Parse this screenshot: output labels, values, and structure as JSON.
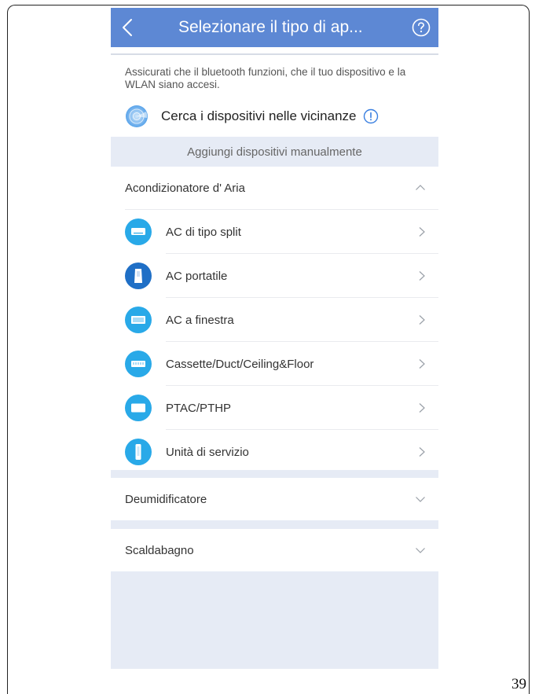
{
  "topbar": {
    "title": "Selezionare il tipo di ap...",
    "back_icon": "chevron-left-icon",
    "help_icon": "question-circle-icon"
  },
  "intro": {
    "text": "Assicurati che il bluetooth funzioni, che il tuo dispositivo e la WLAN siano accesi."
  },
  "nearby": {
    "label": "Cerca i dispositivi nelle vicinanze",
    "icon": "radar-icon",
    "info_icon": "info-icon"
  },
  "manual": {
    "label": "Aggiungi dispositivi manualmente"
  },
  "categories": [
    {
      "label": "Acondizionatore d' Aria",
      "expanded": true,
      "items": [
        {
          "label": "AC di tipo split",
          "icon": "split-ac-icon"
        },
        {
          "label": "AC portatile",
          "icon": "portable-ac-icon"
        },
        {
          "label": "AC a finestra",
          "icon": "window-ac-icon"
        },
        {
          "label": "Cassette/Duct/Ceiling&Floor",
          "icon": "cassette-ac-icon"
        },
        {
          "label": "PTAC/PTHP",
          "icon": "ptac-icon"
        },
        {
          "label": "Unità di servizio",
          "icon": "service-unit-icon"
        }
      ]
    },
    {
      "label": "Deumidificatore",
      "expanded": false
    },
    {
      "label": "Scaldabagno",
      "expanded": false
    }
  ],
  "colors": {
    "header": "#5d88d4",
    "icon_light": "#29a9e8",
    "icon_dark": "#1f6fc6",
    "section_bg": "#e6ebf5"
  },
  "page_number": "39"
}
